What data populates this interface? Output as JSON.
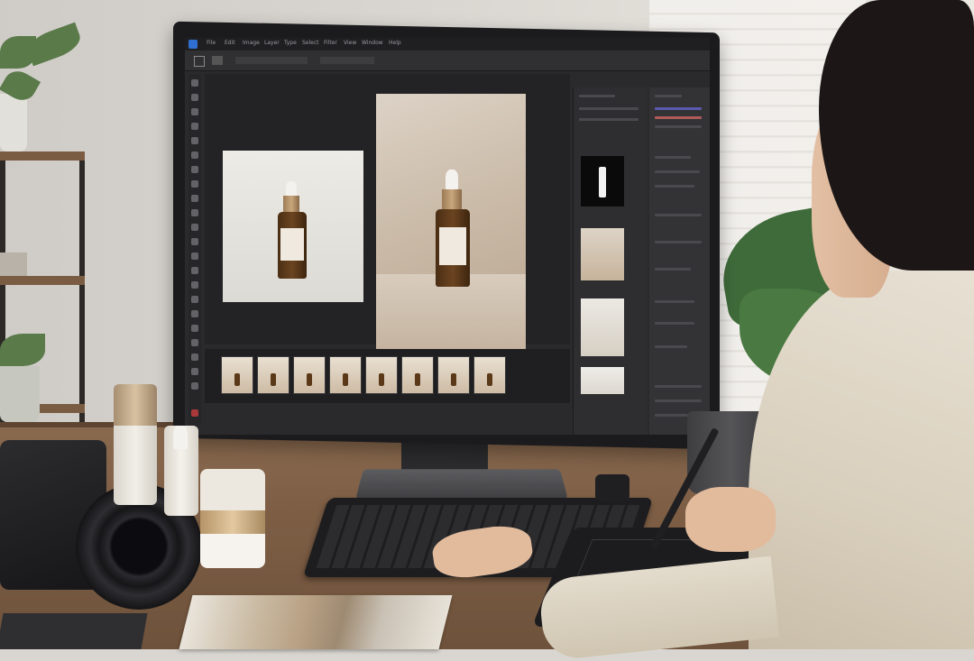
{
  "scene": {
    "description_label": "",
    "monitor": {
      "app_menu": [
        "File",
        "Edit",
        "Image",
        "Layer",
        "Type",
        "Select",
        "Filter",
        "View",
        "Window",
        "Help"
      ]
    },
    "palette": {
      "desk": "#7d5e45",
      "screen_bg": "#2a2a2c",
      "bottle_amber": "#6b4420",
      "accent_gold": "#c9a77c"
    },
    "icons": {
      "home": "home-icon",
      "move": "move-tool-icon"
    }
  }
}
